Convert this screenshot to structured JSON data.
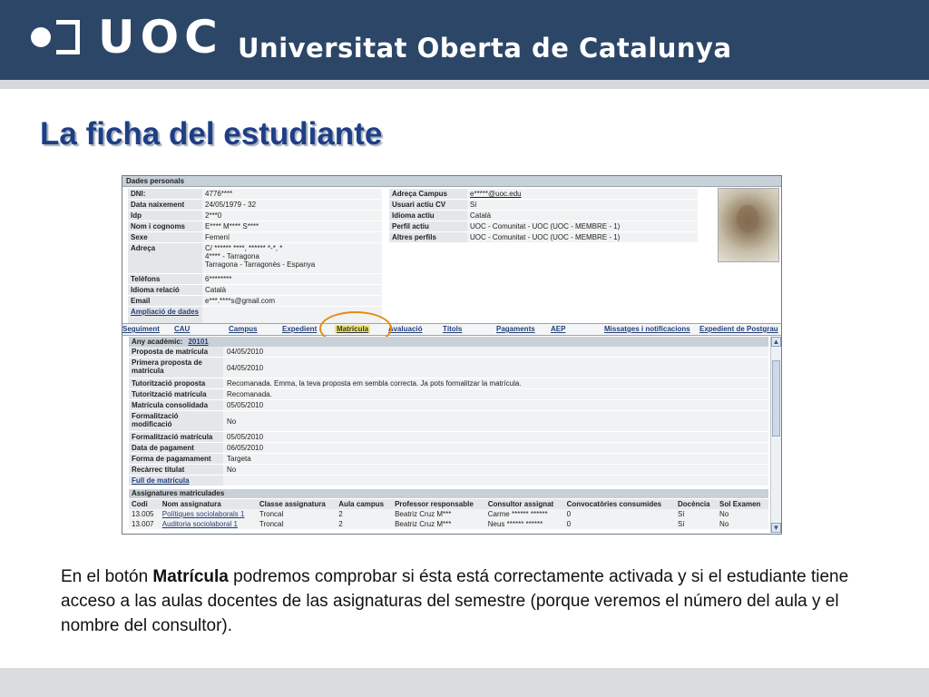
{
  "brand": {
    "letters": "UOC",
    "name": "Universitat Oberta de Catalunya"
  },
  "slide": {
    "title": "La ficha del estudiante"
  },
  "dades": {
    "header": "Dades personals",
    "left": [
      {
        "k": "DNI:",
        "v": "4776****"
      },
      {
        "k": "Data naixement",
        "v": "24/05/1979 - 32"
      },
      {
        "k": "Idp",
        "v": "2***0"
      },
      {
        "k": "Nom i cognoms",
        "v": "E**** M**** S****"
      },
      {
        "k": "Sexe",
        "v": "Femení"
      },
      {
        "k": "Adreça",
        "v": "C/ ****** ****, ****** *-*, *\n4**** - Tarragona\nTarragona - Tarragonès - Espanya"
      },
      {
        "k": "Telèfons",
        "v": "6********"
      },
      {
        "k": "Idioma relació",
        "v": "Català"
      },
      {
        "k": "Email",
        "v": "e***.****s@gmail.com"
      },
      {
        "k": "Ampliació de dades",
        "v": ""
      }
    ],
    "right": [
      {
        "k": "Adreça Campus",
        "v": "e*****@uoc.edu"
      },
      {
        "k": "Usuari actiu CV",
        "v": "Sí"
      },
      {
        "k": "Idioma actiu",
        "v": "Català"
      },
      {
        "k": "Perfil actiu",
        "v": "UOC - Comunitat - UOC (UOC - MEMBRE - 1)"
      },
      {
        "k": "Altres perfils",
        "v": "UOC - Comunitat - UOC (UOC - MEMBRE - 1)"
      }
    ]
  },
  "tabs": [
    "Seguiment",
    "CAU",
    "Campus",
    "Expedient",
    "Matrícula",
    "Avaluació",
    "Títols",
    "Pagaments",
    "AEP",
    "Missatges i notificacions",
    "Expedient de Postgrau"
  ],
  "matricula": {
    "any_label": "Any acadèmic:",
    "any_value": "20101",
    "rows": [
      {
        "k": "Proposta de matrícula",
        "v": "04/05/2010"
      },
      {
        "k": "Primera proposta de matrícula",
        "v": "04/05/2010"
      },
      {
        "k": "Tutorització proposta",
        "v": "Recomanada. Emma, la teva proposta em sembla correcta. Ja pots formalitzar la matrícula."
      },
      {
        "k": "Tutorització matrícula",
        "v": "Recomanada."
      },
      {
        "k": "Matrícula consolidada",
        "v": "05/05/2010"
      },
      {
        "k": "Formalització modificació",
        "v": "No"
      },
      {
        "k": "Formalització matrícula",
        "v": "05/05/2010"
      },
      {
        "k": "Data de pagament",
        "v": "06/05/2010"
      },
      {
        "k": "Forma de pagamament",
        "v": "Targeta"
      },
      {
        "k": "Recàrrec titulat",
        "v": "No"
      },
      {
        "k": "Full de matrícula",
        "v": ""
      }
    ]
  },
  "assignatures": {
    "header": "Assignatures matriculades",
    "columns": [
      "Codi",
      "Nom assignatura",
      "Classe assignatura",
      "Aula campus",
      "Professor responsable",
      "Consultor assignat",
      "Convocatòries consumides",
      "Docència",
      "Sol Examen"
    ],
    "rows": [
      [
        "13.005",
        "Polítiques sociolaborals 1",
        "Troncal",
        "2",
        "Beatriz Cruz M***",
        "Carme ****** ******",
        "0",
        "Sí",
        "No"
      ],
      [
        "13.007",
        "Auditoria sociolaboral 1",
        "Troncal",
        "2",
        "Beatriz Cruz M***",
        "Neus ****** ******",
        "0",
        "Sí",
        "No"
      ]
    ]
  },
  "caption": {
    "pre": "En el botón ",
    "bold": "Matrícula",
    "post": " podremos comprobar si ésta está correctamente activada y si el estudiante tiene acceso a las aulas docentes de las asignaturas del semestre (porque veremos el número del aula y el nombre del consultor)."
  },
  "colors": {
    "header_bg": "#2c4668",
    "title": "#1e3e86",
    "highlight_ring": "#e58b12",
    "active_tab": "#f2e86a"
  }
}
